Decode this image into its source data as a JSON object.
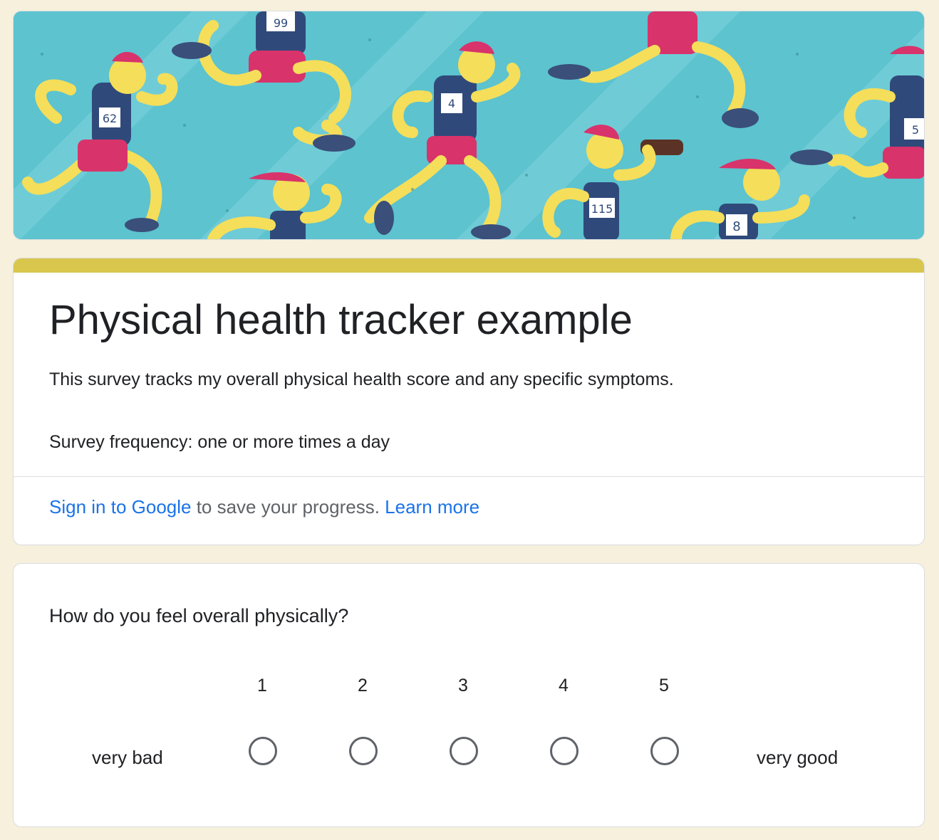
{
  "form": {
    "title": "Physical health tracker example",
    "description_line1": "This survey tracks my overall physical health score and any specific symptoms.",
    "description_line2": "Survey frequency: one or more times a day",
    "signin": {
      "link_text": "Sign in to Google",
      "middle_text": " to save your progress. ",
      "learn_more": "Learn more"
    },
    "accent_color": "#d9c64d",
    "background_color": "#f6f0dc",
    "link_color": "#1a73e8"
  },
  "banner": {
    "bib_numbers": [
      "99",
      "62",
      "4",
      "115",
      "8",
      "5"
    ]
  },
  "question": {
    "text": "How do you feel overall physically?",
    "scale": [
      "1",
      "2",
      "3",
      "4",
      "5"
    ],
    "low_label": "very bad",
    "high_label": "very good",
    "selected": null
  }
}
